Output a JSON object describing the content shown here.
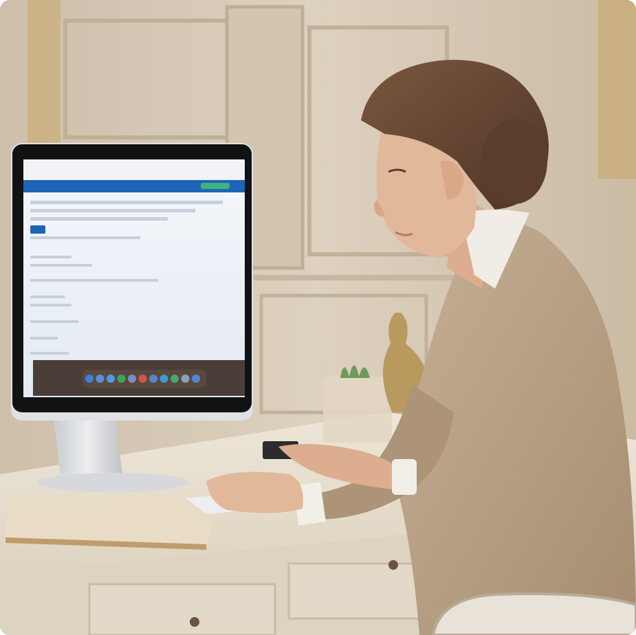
{
  "scene": {
    "subject": "woman-at-computer",
    "setting": "classical-paneled-office",
    "palette": {
      "wall": "#d9cbb8",
      "wall_shadow": "#c4b39c",
      "desk": "#e6ddcd",
      "blazer": "#b79f84",
      "hair": "#6b4a36",
      "skin": "#e2b89a",
      "screen_header": "#1e64b8",
      "screen_body": "#eef2f7",
      "dock_bg": "#3a2b24",
      "book": "#e9dcc6",
      "plant": "#6f9a5c",
      "gold": "#b99a5e"
    }
  },
  "monitor": {
    "screen": {
      "app_header_color": "#1e64b8",
      "primary_button_color": "#1e64b8"
    },
    "dock": {
      "icons": [
        {
          "name": "finder-icon",
          "color": "#3d7fd9"
        },
        {
          "name": "app-icon-2",
          "color": "#5b8fd6"
        },
        {
          "name": "app-icon-3",
          "color": "#4c9be0"
        },
        {
          "name": "maps-icon",
          "color": "#3aa65a"
        },
        {
          "name": "app-icon-5",
          "color": "#7a8fbf"
        },
        {
          "name": "app-icon-6",
          "color": "#d0574a"
        },
        {
          "name": "app-icon-7",
          "color": "#5a84c7"
        },
        {
          "name": "app-icon-8",
          "color": "#3c9ad0"
        },
        {
          "name": "app-icon-9",
          "color": "#45a870"
        },
        {
          "name": "app-icon-10",
          "color": "#8aa0c2"
        },
        {
          "name": "app-icon-11",
          "color": "#4f86d4"
        }
      ]
    }
  }
}
